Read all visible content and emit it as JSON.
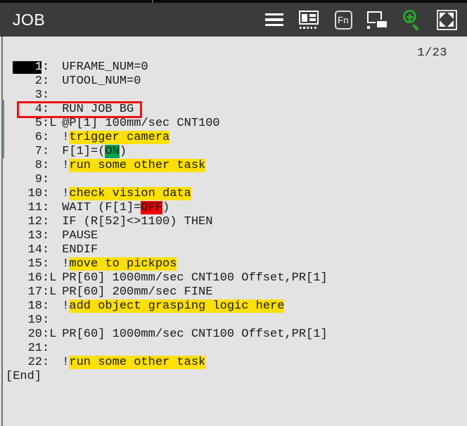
{
  "titlebar": {
    "title": "JOB",
    "icons": [
      {
        "name": "menu-icon",
        "label": "Menu"
      },
      {
        "name": "layout-icon",
        "label": "Layout"
      },
      {
        "name": "fn-icon",
        "label": "Fn"
      },
      {
        "name": "windows-icon",
        "label": "Windows"
      },
      {
        "name": "zoom-in-icon",
        "label": "Zoom In"
      },
      {
        "name": "fullscreen-icon",
        "label": "Fullscreen"
      }
    ],
    "background_color": "#3b3b3b",
    "title_color": "#ffffff",
    "zoom_icon_color": "#2aa62a"
  },
  "editor": {
    "page_indicator": "1/23",
    "background_color": "#e3e3e3",
    "cursor_line": 1,
    "highlight_box_line": 4,
    "highlight_box_color": "#ee1111",
    "comment_highlight_color": "#ffe000",
    "on_highlight_color": "#00a64a",
    "off_highlight_color": "#ee0000",
    "end_marker": "[End]",
    "lines": [
      {
        "no": "1",
        "mod": "",
        "text": "UFRAME_NUM=0"
      },
      {
        "no": "2",
        "mod": "",
        "text": "UTOOL_NUM=0"
      },
      {
        "no": "3",
        "mod": "",
        "text": ""
      },
      {
        "no": "4",
        "mod": "",
        "text": "RUN JOB BG"
      },
      {
        "no": "5",
        "mod": "L",
        "text": "@P[1] 100mm/sec CNT100"
      },
      {
        "no": "6",
        "mod": "",
        "text": "!trigger camera"
      },
      {
        "no": "7",
        "mod": "",
        "text": "F[1]=(ON)"
      },
      {
        "no": "8",
        "mod": "",
        "text": "!run some other task"
      },
      {
        "no": "9",
        "mod": "",
        "text": ""
      },
      {
        "no": "10",
        "mod": "",
        "text": "!check vision data"
      },
      {
        "no": "11",
        "mod": "",
        "text": "WAIT (F[1]=OFF)"
      },
      {
        "no": "12",
        "mod": "",
        "text": "IF (R[52]<>1100) THEN"
      },
      {
        "no": "13",
        "mod": "",
        "text": "PAUSE"
      },
      {
        "no": "14",
        "mod": "",
        "text": "ENDIF"
      },
      {
        "no": "15",
        "mod": "",
        "text": "!move to pickpos"
      },
      {
        "no": "16",
        "mod": "L",
        "text": "PR[60] 1000mm/sec CNT100 Offset,PR[1]"
      },
      {
        "no": "17",
        "mod": "L",
        "text": "PR[60] 200mm/sec FINE"
      },
      {
        "no": "18",
        "mod": "",
        "text": "!add object grasping logic here"
      },
      {
        "no": "19",
        "mod": "",
        "text": ""
      },
      {
        "no": "20",
        "mod": "L",
        "text": "PR[60] 1000mm/sec CNT100 Offset,PR[1]"
      },
      {
        "no": "21",
        "mod": "",
        "text": ""
      },
      {
        "no": "22",
        "mod": "",
        "text": "!run some other task"
      }
    ]
  }
}
